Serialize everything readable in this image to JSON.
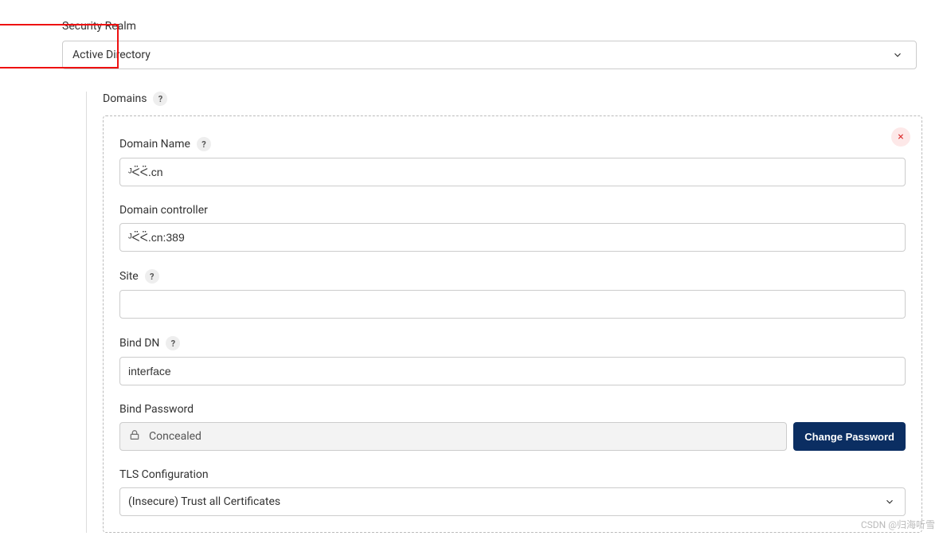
{
  "top": {
    "label": "Security Realm",
    "selected": "Active Directory"
  },
  "domains_section": {
    "title": "Domains",
    "remove_glyph": "×",
    "fields": {
      "domain_name": {
        "label": "Domain Name",
        "value": "ᴶᑈᑈ.cn"
      },
      "domain_controller": {
        "label": "Domain controller",
        "value": "ᴶᑈᑈ.cn:389"
      },
      "site": {
        "label": "Site",
        "value": ""
      },
      "bind_dn": {
        "label": "Bind DN",
        "value": "interface"
      },
      "bind_password": {
        "label": "Bind Password",
        "value_display": "Concealed",
        "button": "Change Password"
      },
      "tls": {
        "label": "TLS Configuration",
        "selected": "(Insecure) Trust all Certificates"
      }
    }
  },
  "help_glyph": "?",
  "watermark": "CSDN @归海听雪"
}
